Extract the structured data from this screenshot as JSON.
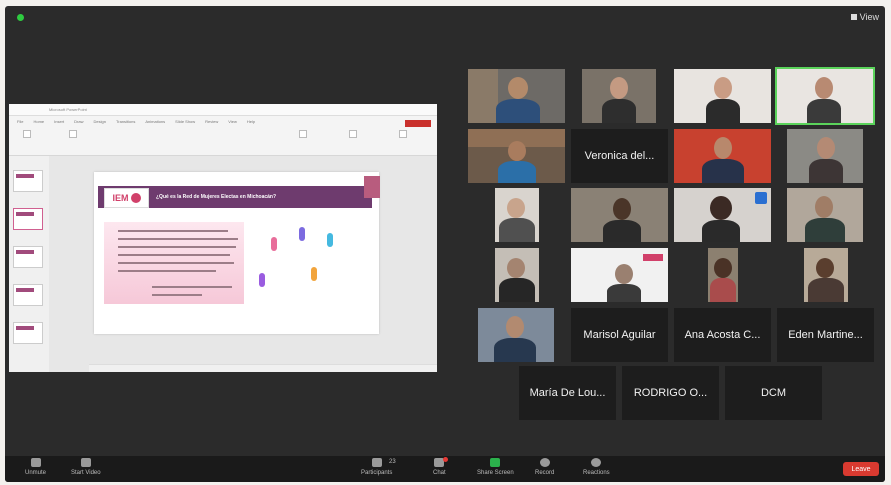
{
  "window": {
    "view_label": "View"
  },
  "shared_screen": {
    "app_title": "Microsoft PowerPoint",
    "ribbon_tabs": [
      "File",
      "Home",
      "Insert",
      "Draw",
      "Design",
      "Transitions",
      "Animations",
      "Slide Show",
      "Review",
      "View",
      "Help"
    ],
    "slide": {
      "logo_text": "IEM",
      "title": "¿Qué es la Red de Mujeres Electas en Michoacán?"
    }
  },
  "participants": [
    {
      "id": "p1",
      "name": "",
      "type": "video"
    },
    {
      "id": "p2",
      "name": "",
      "type": "video"
    },
    {
      "id": "p3",
      "name": "",
      "type": "video"
    },
    {
      "id": "p4",
      "name": "",
      "type": "video",
      "active_speaker": true
    },
    {
      "id": "p5",
      "name": "",
      "type": "video"
    },
    {
      "id": "p6",
      "name": "Veronica del...",
      "type": "name"
    },
    {
      "id": "p7",
      "name": "",
      "type": "video"
    },
    {
      "id": "p8",
      "name": "",
      "type": "video"
    },
    {
      "id": "p9",
      "name": "",
      "type": "video"
    },
    {
      "id": "p10",
      "name": "",
      "type": "video"
    },
    {
      "id": "p11",
      "name": "",
      "type": "video"
    },
    {
      "id": "p12",
      "name": "",
      "type": "video"
    },
    {
      "id": "p13",
      "name": "",
      "type": "video"
    },
    {
      "id": "p14",
      "name": "",
      "type": "video"
    },
    {
      "id": "p15",
      "name": "",
      "type": "video"
    },
    {
      "id": "p16",
      "name": "",
      "type": "video"
    },
    {
      "id": "p17",
      "name": "",
      "type": "video"
    },
    {
      "id": "p18",
      "name": "Marisol Aguilar",
      "type": "name"
    },
    {
      "id": "p19",
      "name": "Ana Acosta C...",
      "type": "name"
    },
    {
      "id": "p20",
      "name": "Eden Martine...",
      "type": "name"
    },
    {
      "id": "p21",
      "name": "María De Lou...",
      "type": "name"
    },
    {
      "id": "p22",
      "name": "RODRIGO O...",
      "type": "name"
    },
    {
      "id": "p23",
      "name": "DCM",
      "type": "name"
    }
  ],
  "toolbar": {
    "mute": "Unmute",
    "video": "Start Video",
    "participants": "Participants",
    "participants_count": "23",
    "chat": "Chat",
    "share": "Share Screen",
    "record": "Record",
    "reactions": "Reactions",
    "leave": "Leave"
  },
  "colors": {
    "accent": "#2ecc40",
    "leave": "#d93a30",
    "slide_banner": "#6e3b6e"
  }
}
